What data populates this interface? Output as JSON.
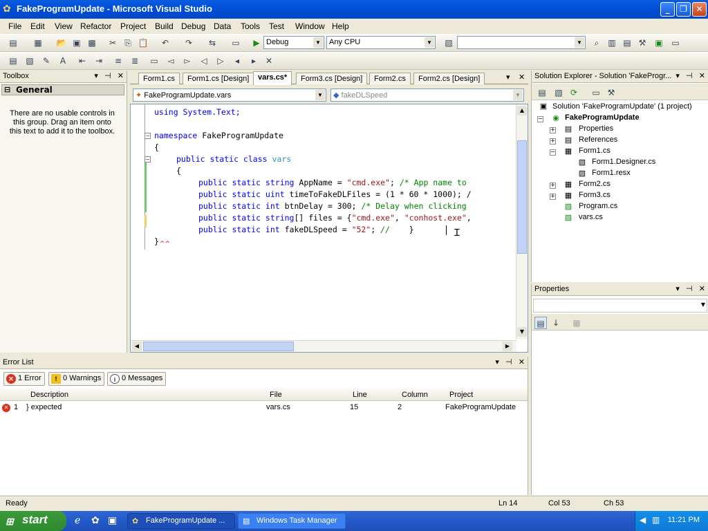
{
  "window": {
    "title": "FakeProgramUpdate - Microsoft Visual Studio",
    "controls": [
      "_",
      "❐",
      "✕"
    ]
  },
  "menu": [
    "File",
    "Edit",
    "View",
    "Refactor",
    "Project",
    "Build",
    "Debug",
    "Data",
    "Tools",
    "Test",
    "Window",
    "Help"
  ],
  "toolbar": {
    "config": "Debug",
    "platform": "Any CPU",
    "find": ""
  },
  "toolbox": {
    "title": "Toolbox",
    "group": "General",
    "message": "There are no usable controls in this group. Drag an item onto this text to add it to the toolbox."
  },
  "editor": {
    "tabs": [
      "Form1.cs",
      "Form1.cs [Design]",
      "vars.cs*",
      "Form3.cs [Design]",
      "Form2.cs",
      "Form2.cs [Design]"
    ],
    "active_tab": "vars.cs*",
    "class_combo": "FakeProgramUpdate.vars",
    "member_combo": "fakeDLSpeed"
  },
  "code": {
    "line1": "using System.Text;",
    "ns_kw": "namespace",
    "ns_name": " FakeProgramUpdate",
    "brace_open": "{",
    "cls_kw": "public static class",
    "cls_name": " vars",
    "cls_brace": "{",
    "l1_kw": "public static string",
    "l1_rest": " AppName = ",
    "l1_str": "\"cmd.exe\"",
    "l1_mid": "; ",
    "l1_cmt": "/* App name to",
    "l2_kw": "public static uint",
    "l2_rest": " timeToFakeDLFiles = (1 * 60 * 1000); /",
    "l3_kw": "public static int",
    "l3_rest": " btnDelay = 300; ",
    "l3_cmt": "/* Delay when clicking",
    "l4_kw": "public static string",
    "l4_rest": "[] files = {",
    "l4_str1": "\"cmd.exe\"",
    "l4_mid": ", ",
    "l4_str2": "\"conhost.exe\"",
    "l4_end": ",",
    "l5_kw": "public static int",
    "l5_rest": " fakeDLSpeed = ",
    "l5_str": "\"52\"",
    "l5_mid": "; ",
    "l5_cmt": "//",
    "l5_end": "    }",
    "brace_close": "}"
  },
  "error_list": {
    "title": "Error List",
    "errors_btn": "1 Error",
    "warnings_btn": "0 Warnings",
    "messages_btn": "0 Messages",
    "columns": [
      "Description",
      "File",
      "Line",
      "Column",
      "Project"
    ],
    "rows": [
      {
        "num": "1",
        "description": "} expected",
        "file": "vars.cs",
        "line": "15",
        "column": "2",
        "project": "FakeProgramUpdate"
      }
    ]
  },
  "solution_explorer": {
    "title": "Solution Explorer - Solution 'FakeProgr...",
    "solution": "Solution 'FakeProgramUpdate' (1 project)",
    "project": "FakeProgramUpdate",
    "items": [
      "Properties",
      "References",
      "Form1.cs",
      "Form1.Designer.cs",
      "Form1.resx",
      "Form2.cs",
      "Form3.cs",
      "Program.cs",
      "vars.cs"
    ]
  },
  "properties": {
    "title": "Properties"
  },
  "status": {
    "text": "Ready",
    "ln": "Ln 14",
    "col": "Col 53",
    "ch": "Ch 53"
  },
  "taskbar": {
    "start": "start",
    "tasks": [
      "FakeProgramUpdate ...",
      "Windows Task Manager"
    ],
    "clock": "11:21 PM"
  }
}
